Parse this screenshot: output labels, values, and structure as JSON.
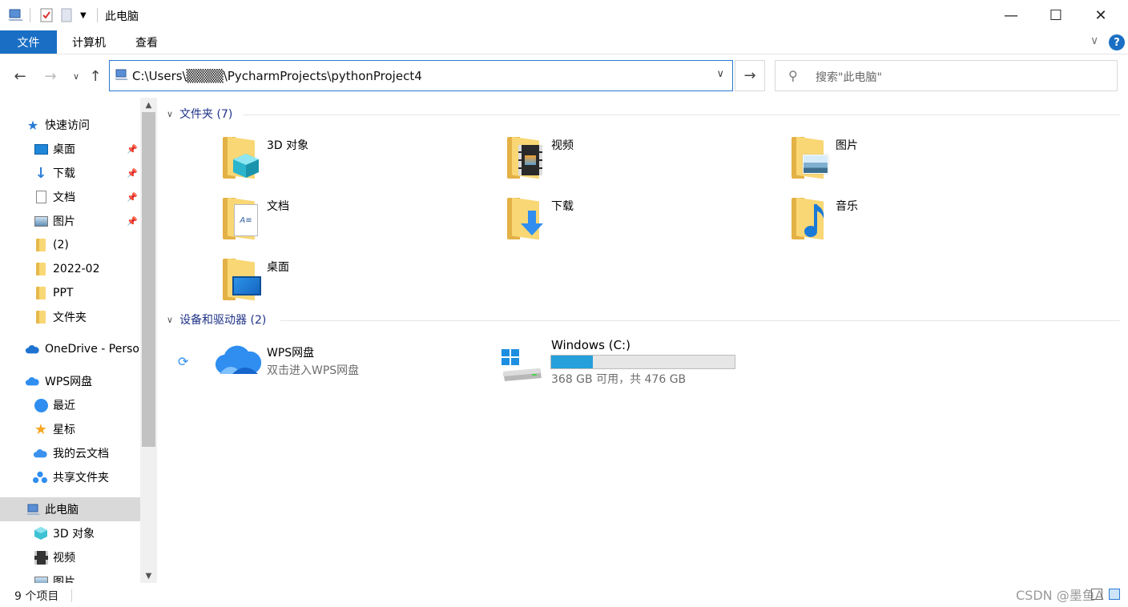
{
  "window": {
    "title": "此电脑",
    "minimize": "—",
    "maximize": "☐",
    "close": "✕"
  },
  "ribbon": {
    "tabs": [
      "文件",
      "计算机",
      "查看"
    ],
    "expand": "∨",
    "help": "?"
  },
  "nav": {
    "back": "←",
    "forward": "→",
    "recent": "∨",
    "up": "↑",
    "address": "C:\\Users\\▒▒▒▒\\PycharmProjects\\pythonProject4",
    "go": "→",
    "search_placeholder": "搜索\"此电脑\""
  },
  "sidebar": {
    "quick_access": "快速访问",
    "pinned": [
      {
        "label": "桌面",
        "icon": "desktop-icon"
      },
      {
        "label": "下载",
        "icon": "download-icon"
      },
      {
        "label": "文档",
        "icon": "document-icon"
      },
      {
        "label": "图片",
        "icon": "picture-icon"
      }
    ],
    "folders": [
      "(2)",
      "2022-02",
      "PPT",
      "文件夹"
    ],
    "onedrive": "OneDrive - Personal",
    "wps": "WPS网盘",
    "wps_items": [
      {
        "label": "最近",
        "icon": "clock-icon"
      },
      {
        "label": "星标",
        "icon": "star-icon"
      },
      {
        "label": "我的云文档",
        "icon": "cloud-doc-icon"
      },
      {
        "label": "共享文件夹",
        "icon": "share-icon"
      }
    ],
    "this_pc": "此电脑",
    "pc_items": [
      {
        "label": "3D 对象",
        "icon": "cube-icon"
      },
      {
        "label": "视频",
        "icon": "video-icon"
      },
      {
        "label": "图片",
        "icon": "picture-icon"
      }
    ]
  },
  "main": {
    "folders_header": "文件夹 (7)",
    "folders": [
      {
        "name": "3D 对象",
        "icon": "cube-folder-icon"
      },
      {
        "name": "视频",
        "icon": "video-folder-icon"
      },
      {
        "name": "图片",
        "icon": "picture-folder-icon"
      },
      {
        "name": "文档",
        "icon": "document-folder-icon"
      },
      {
        "name": "下载",
        "icon": "download-folder-icon"
      },
      {
        "name": "音乐",
        "icon": "music-folder-icon"
      },
      {
        "name": "桌面",
        "icon": "desktop-folder-icon"
      }
    ],
    "devices_header": "设备和驱动器 (2)",
    "wps_drive": {
      "name": "WPS网盘",
      "subtitle": "双击进入WPS网盘"
    },
    "c_drive": {
      "name": "Windows (C:)",
      "space": "368 GB 可用，共 476 GB",
      "used_fraction": 0.227
    }
  },
  "status": {
    "items": "9 个项目",
    "watermark": "CSDN @墨鱼A"
  },
  "colors": {
    "accent": "#1a6fc4",
    "group_header": "#1e3287",
    "drive_fill": "#26a0da"
  }
}
